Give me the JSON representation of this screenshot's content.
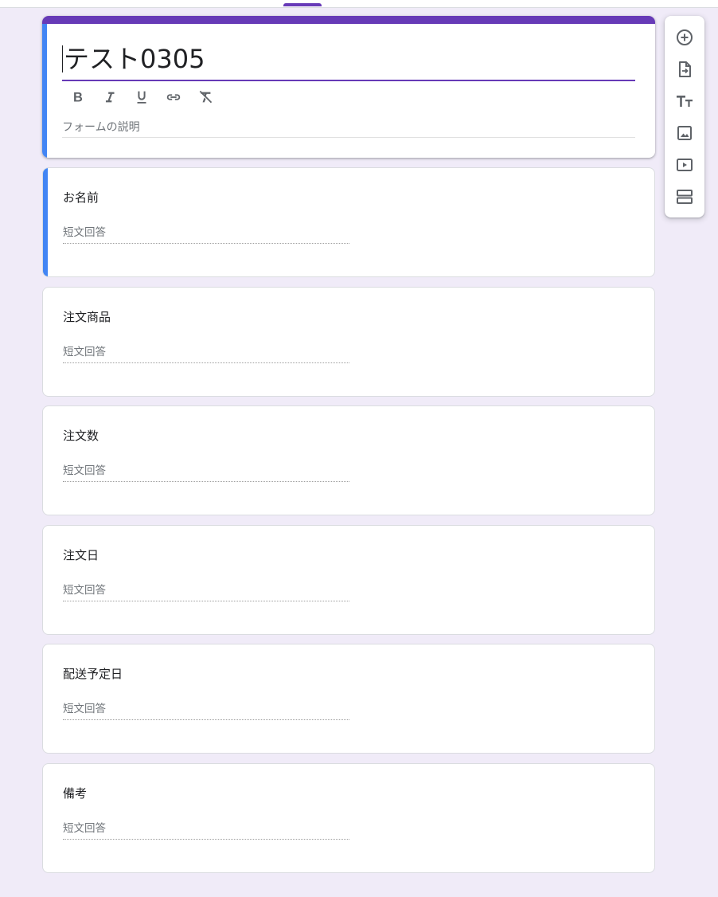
{
  "form": {
    "title": "テスト0305",
    "description_placeholder": "フォームの説明",
    "accent_color": "#673ab7",
    "active_accent_color": "#4285f4"
  },
  "format_toolbar": {
    "items": [
      {
        "name": "bold-icon",
        "glyph": "B"
      },
      {
        "name": "italic-icon",
        "glyph": "I"
      },
      {
        "name": "underline-icon",
        "glyph": "U"
      },
      {
        "name": "link-icon"
      },
      {
        "name": "clear-formatting-icon"
      }
    ]
  },
  "questions": [
    {
      "title": "お名前",
      "placeholder": "短文回答",
      "active": true
    },
    {
      "title": "注文商品",
      "placeholder": "短文回答",
      "active": false
    },
    {
      "title": "注文数",
      "placeholder": "短文回答",
      "active": false
    },
    {
      "title": "注文日",
      "placeholder": "短文回答",
      "active": false
    },
    {
      "title": "配送予定日",
      "placeholder": "短文回答",
      "active": false
    },
    {
      "title": "備考",
      "placeholder": "短文回答",
      "active": false
    }
  ],
  "side_toolbar": {
    "items": [
      {
        "name": "add-question-icon"
      },
      {
        "name": "import-questions-icon"
      },
      {
        "name": "add-title-description-icon"
      },
      {
        "name": "add-image-icon"
      },
      {
        "name": "add-video-icon"
      },
      {
        "name": "add-section-icon"
      }
    ]
  }
}
